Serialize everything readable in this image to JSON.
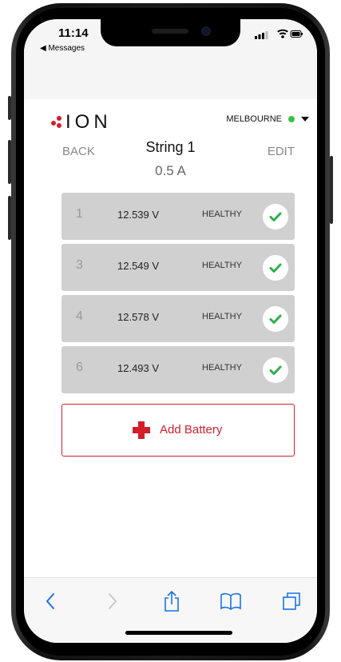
{
  "status_bar": {
    "time": "11:14",
    "back_app": "◀ Messages"
  },
  "app": {
    "logo_text": "ION",
    "location": "MELBOURNE",
    "location_status_color": "#37c445",
    "accent_color": "#d21e2b"
  },
  "nav": {
    "back_label": "BACK",
    "edit_label": "EDIT",
    "title": "String 1",
    "current": "0.5 A"
  },
  "batteries": [
    {
      "number": "1",
      "voltage": "12.539 V",
      "status": "HEALTHY",
      "icon": "check-icon"
    },
    {
      "number": "3",
      "voltage": "12.549 V",
      "status": "HEALTHY",
      "icon": "check-icon"
    },
    {
      "number": "4",
      "voltage": "12.578 V",
      "status": "HEALTHY",
      "icon": "check-icon"
    },
    {
      "number": "6",
      "voltage": "12.493 V",
      "status": "HEALTHY",
      "icon": "check-icon"
    }
  ],
  "add_button": {
    "label": "Add Battery",
    "icon": "plus-icon"
  },
  "safari_toolbar": {
    "items": [
      "back-icon",
      "forward-icon",
      "share-icon",
      "bookmarks-icon",
      "tabs-icon"
    ]
  }
}
